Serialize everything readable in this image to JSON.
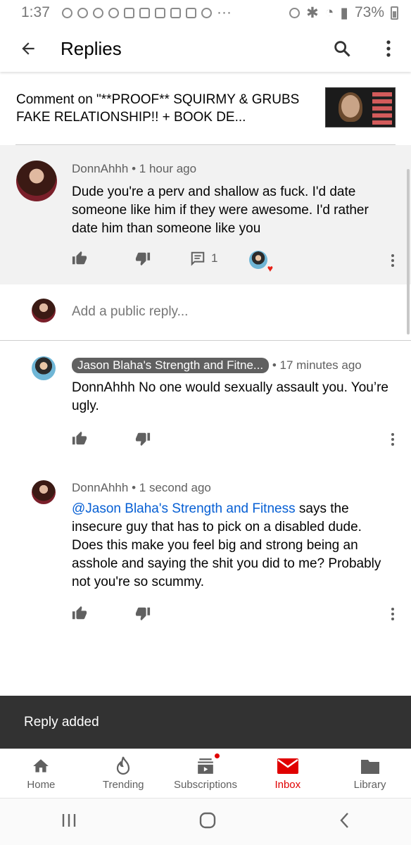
{
  "status_bar": {
    "time": "1:37",
    "battery": "73%"
  },
  "app_bar": {
    "title": "Replies"
  },
  "video": {
    "comment_on": "Comment on \"**PROOF** SQUIRMY & GRUBS FAKE RELATIONSHIP!! + BOOK DE..."
  },
  "parent_comment": {
    "author": "DonnAhhh",
    "time": "1 hour ago",
    "text": "Dude you're a perv and shallow as fuck. I'd date someone like him if they were awesome. I'd rather date him than  someone like you",
    "reply_count": "1"
  },
  "reply_input": {
    "placeholder": "Add a public reply..."
  },
  "replies": [
    {
      "author": "Jason Blaha's Strength and Fitne...",
      "time": "17 minutes ago",
      "text": "DonnAhhh No one would sexually assault you. You’re ugly."
    },
    {
      "author": "DonnAhhh",
      "time": "1 second ago",
      "mention": "@Jason Blaha's Strength and Fitness",
      "text": " says the insecure guy that has to pick on a disabled dude. Does this make you feel big and strong being an asshole and saying the shit you did to me? Probably not you're so scummy."
    }
  ],
  "snackbar": {
    "message": "Reply added"
  },
  "bottom_nav": {
    "items": [
      {
        "label": "Home",
        "icon": "home-icon"
      },
      {
        "label": "Trending",
        "icon": "trending-icon"
      },
      {
        "label": "Subscriptions",
        "icon": "subscriptions-icon"
      },
      {
        "label": "Inbox",
        "icon": "inbox-icon",
        "active": true
      },
      {
        "label": "Library",
        "icon": "library-icon"
      }
    ]
  },
  "colors": {
    "accent": "#e00000",
    "link": "#065fd4",
    "snackbar": "#323232",
    "highlight_bg": "#f2f2f2"
  }
}
